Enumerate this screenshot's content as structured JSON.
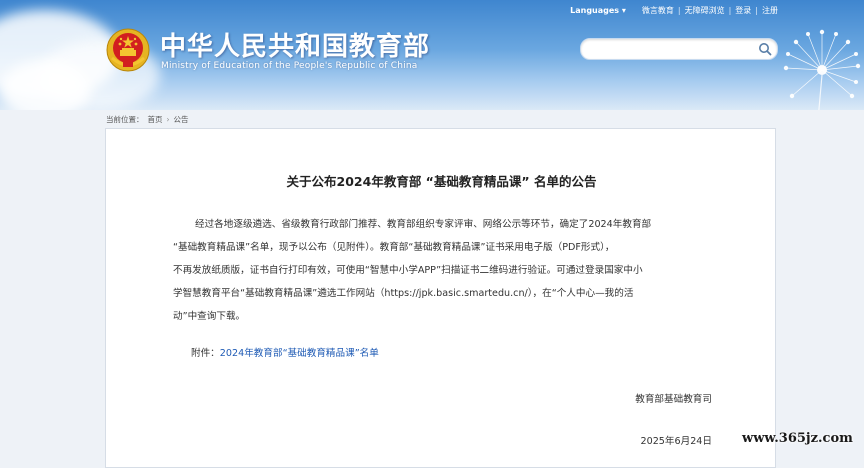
{
  "header": {
    "site_title_cn": "中华人民共和国教育部",
    "site_title_en": "Ministry of Education of the People's Republic of China",
    "top_links": {
      "languages": "Languages",
      "weibo": "微言教育",
      "accessibility": "无障碍浏览",
      "login": "登录",
      "register": "注册",
      "separator": "|"
    },
    "search": {
      "value": "",
      "placeholder": ""
    }
  },
  "breadcrumb": {
    "prefix": "当前位置：",
    "home": "首页",
    "chevron": "›",
    "current": "公告"
  },
  "article": {
    "title": "关于公布2024年教育部 “基础教育精品课” 名单的公告",
    "body_lines": [
      "经过各地逐级遴选、省级教育行政部门推荐、教育部组织专家评审、网络公示等环节，确定了2024年教育部",
      "“基础教育精品课”名单，现予以公布（见附件）。教育部“基础教育精品课”证书采用电子版（PDF形式），",
      "不再发放纸质版，证书自行打印有效，可使用“智慧中小学APP”扫描证书二维码进行验证。可通过登录国家中小",
      "学智慧教育平台“基础教育精品课”遴选工作网站（https://jpk.basic.smartedu.cn/），在“个人中心—我的活",
      "动”中查询下载。"
    ],
    "attachment_label": "附件：",
    "attachment_link": "2024年教育部“基础教育精品课”名单",
    "signer": "教育部基础教育司",
    "date": "2025年6月24日"
  },
  "watermark": "www.365jz.com",
  "colors": {
    "header_blue": "#3f86cf",
    "link_blue": "#1f5bb5",
    "emblem_red": "#d21f1f",
    "emblem_gold": "#f4c430"
  },
  "icons": {
    "emblem": "national-emblem-icon",
    "search": "search-icon",
    "languages_dropdown": "chevron-down-icon",
    "decor": "dandelion-decoration"
  }
}
